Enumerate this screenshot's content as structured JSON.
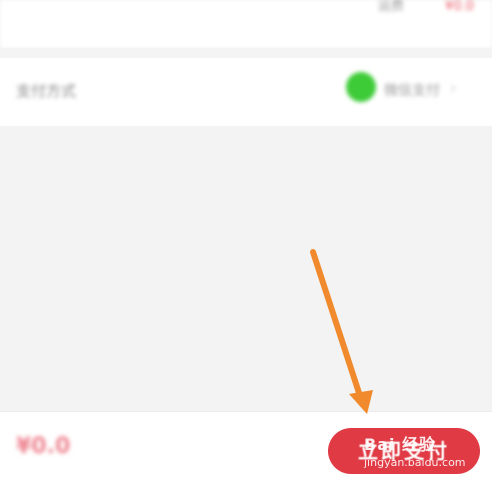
{
  "top_row": {
    "left_text": "运费",
    "right_text": "¥0.0"
  },
  "payment_row": {
    "label": "支付方式",
    "method": "微信支付",
    "chevron": "›",
    "icon": "wechat-pay-icon"
  },
  "bottom_bar": {
    "price": "¥0.0",
    "pay_button_label": "立即支付"
  },
  "watermark": {
    "logo_text": "Bai 经验",
    "url": "jingyan.baidu.com"
  },
  "annotation": {
    "arrow_color": "#f08a2c"
  },
  "colors": {
    "accent_red": "#e03b45",
    "wechat_green": "#3ecb38"
  }
}
